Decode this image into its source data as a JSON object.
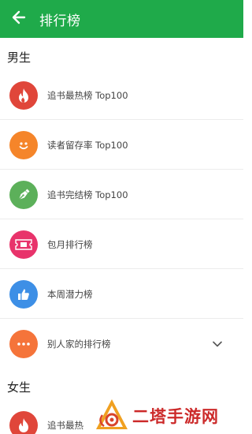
{
  "header": {
    "title": "排行榜",
    "back_icon": "arrow-left-icon",
    "background_color": "#1faa4a"
  },
  "sections": {
    "male": {
      "title": "男生",
      "items": [
        {
          "label": "追书最热榜 Top100",
          "icon": "flame-icon",
          "color": "#e0463a"
        },
        {
          "label": "读者留存率 Top100",
          "icon": "smiley-icon",
          "color": "#f5852a"
        },
        {
          "label": "追书完结榜 Top100",
          "icon": "pen-nib-icon",
          "color": "#5cb05a"
        },
        {
          "label": "包月排行榜",
          "icon": "ticket-icon",
          "color": "#e8336b"
        },
        {
          "label": "本周潜力榜",
          "icon": "thumbs-up-icon",
          "color": "#3d8fe6"
        },
        {
          "label": "别人家的排行榜",
          "icon": "more-dots-icon",
          "color": "#f5743a"
        }
      ]
    },
    "female": {
      "title": "女生",
      "items": [
        {
          "label": "追书最热",
          "icon": "flame-icon",
          "color": "#e0463a"
        }
      ]
    }
  },
  "watermark": {
    "text": "二塔手游网",
    "icon": "spiral-logo-icon"
  }
}
